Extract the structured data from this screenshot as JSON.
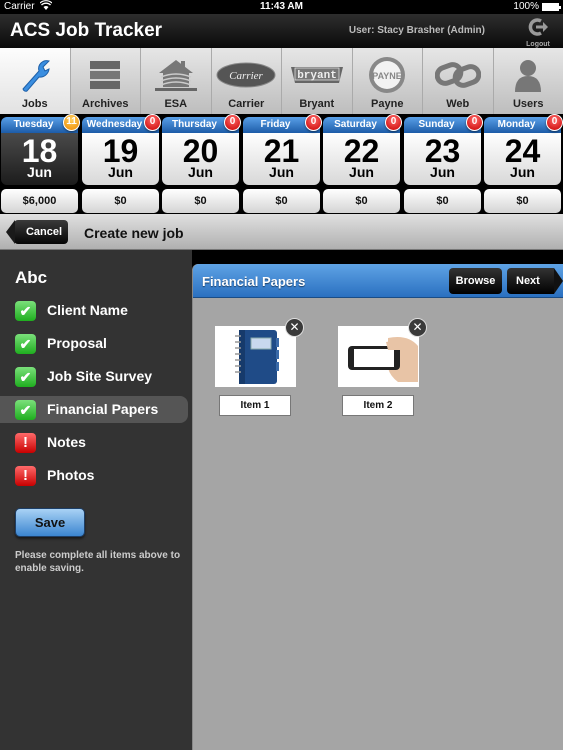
{
  "status_bar": {
    "carrier": "Carrier",
    "time": "11:43 AM",
    "battery": "100%"
  },
  "header": {
    "app_title": "ACS Job Tracker",
    "user": "User: Stacy Brasher (Admin)",
    "logout_label": "Logout",
    "logout_glyph": "⮕"
  },
  "tabs": [
    {
      "label": "Jobs",
      "icon": "wrench-icon",
      "active": true
    },
    {
      "label": "Archives",
      "icon": "archive-drawers-icon"
    },
    {
      "label": "ESA",
      "icon": "house-icon"
    },
    {
      "label": "Carrier",
      "icon": "carrier-logo-icon",
      "logo_text": "Carrier"
    },
    {
      "label": "Bryant",
      "icon": "bryant-logo-icon",
      "logo_text": "bryant"
    },
    {
      "label": "Payne",
      "icon": "payne-logo-icon",
      "logo_text": "PAYNE"
    },
    {
      "label": "Web",
      "icon": "chain-link-icon"
    },
    {
      "label": "Users",
      "icon": "user-silhouette-icon"
    }
  ],
  "calendar": [
    {
      "weekday": "Tuesday",
      "date": "18",
      "month": "Jun",
      "badge": "11",
      "amount": "$6,000",
      "selected": true
    },
    {
      "weekday": "Wednesday",
      "date": "19",
      "month": "Jun",
      "badge": "0",
      "amount": "$0"
    },
    {
      "weekday": "Thursday",
      "date": "20",
      "month": "Jun",
      "badge": "0",
      "amount": "$0"
    },
    {
      "weekday": "Friday",
      "date": "21",
      "month": "Jun",
      "badge": "0",
      "amount": "$0"
    },
    {
      "weekday": "Saturday",
      "date": "22",
      "month": "Jun",
      "badge": "0",
      "amount": "$0"
    },
    {
      "weekday": "Sunday",
      "date": "23",
      "month": "Jun",
      "badge": "0",
      "amount": "$0"
    },
    {
      "weekday": "Monday",
      "date": "24",
      "month": "Jun",
      "badge": "0",
      "amount": "$0"
    }
  ],
  "nav": {
    "cancel_label": "Cancel",
    "title": "Create new job"
  },
  "sidebar": {
    "job_name": "Abc",
    "items": [
      {
        "label": "Client Name",
        "status": "complete",
        "glyph": "✔"
      },
      {
        "label": "Proposal",
        "status": "complete",
        "glyph": "✔"
      },
      {
        "label": "Job Site Survey",
        "status": "complete",
        "glyph": "✔"
      },
      {
        "label": "Financial Papers",
        "status": "complete",
        "glyph": "✔",
        "selected": true
      },
      {
        "label": "Notes",
        "status": "incomplete",
        "glyph": "!"
      },
      {
        "label": "Photos",
        "status": "incomplete",
        "glyph": "!"
      }
    ],
    "save_label": "Save",
    "hint": "Please complete all items above to enable saving."
  },
  "panel": {
    "title": "Financial Papers",
    "browse_label": "Browse",
    "next_label": "Next",
    "items": [
      {
        "caption": "Item 1",
        "thumbnail": "notebook-icon",
        "remove_glyph": "✕"
      },
      {
        "caption": "Item 2",
        "thumbnail": "phone-in-hand-icon",
        "remove_glyph": "✕"
      }
    ]
  },
  "colors": {
    "accent_blue": "#2a70c0",
    "complete_green": "#1fae1f",
    "incomplete_red": "#c80000",
    "badge_orange": "#ee8a00"
  }
}
